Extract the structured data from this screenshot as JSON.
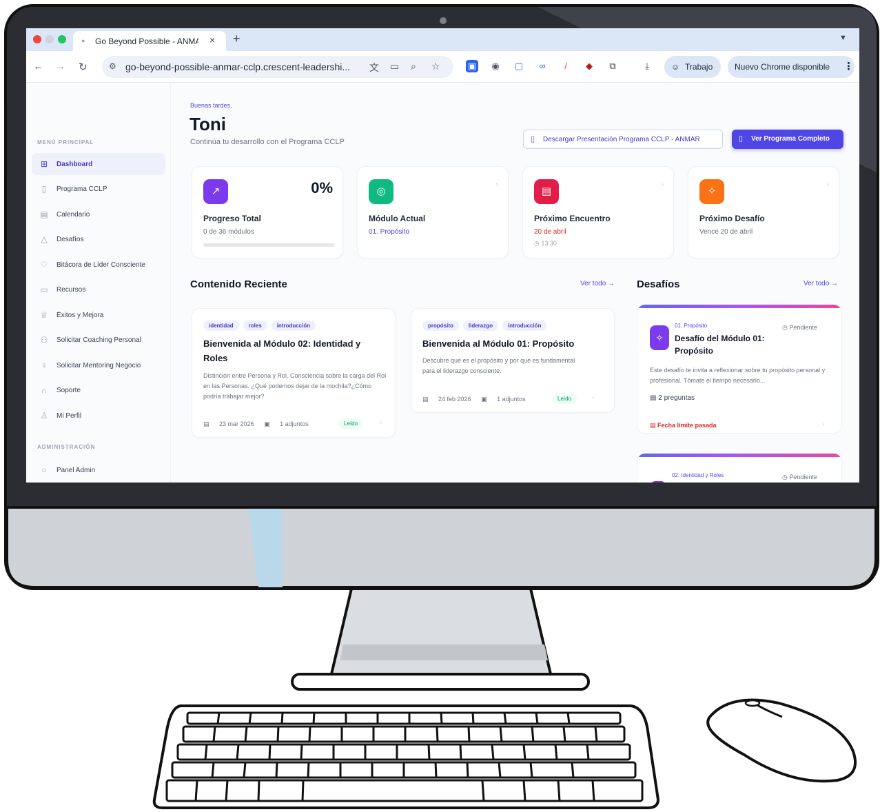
{
  "browser": {
    "tab_title": "Go Beyond Possible - ANMAR",
    "url": "go-beyond-possible-anmar-cclp.crescent-leadershi...",
    "profile_label": "Trabajo",
    "update_label": "Nuevo Chrome disponible"
  },
  "sidebar": {
    "section_main": "MENÚ PRINCIPAL",
    "items": [
      {
        "label": "Dashboard",
        "icon": "grid-icon"
      },
      {
        "label": "Programa CCLP",
        "icon": "book-icon"
      },
      {
        "label": "Calendario",
        "icon": "calendar-icon"
      },
      {
        "label": "Desafíos",
        "icon": "mountain-icon"
      },
      {
        "label": "Bitácora de Líder Consciente",
        "icon": "heart-icon"
      },
      {
        "label": "Recursos",
        "icon": "folder-icon"
      },
      {
        "label": "Éxitos y Mejora",
        "icon": "trophy-icon"
      },
      {
        "label": "Solicitar Coaching Personal",
        "icon": "users-icon"
      },
      {
        "label": "Solicitar Mentoring Negocio",
        "icon": "lightbulb-icon"
      },
      {
        "label": "Soporte",
        "icon": "headphones-icon"
      },
      {
        "label": "Mi Perfil",
        "icon": "user-icon"
      }
    ],
    "section_admin": "ADMINISTRACIÓN",
    "admin_items": [
      {
        "label": "Panel Admin",
        "icon": "shield-icon"
      }
    ]
  },
  "header": {
    "greeting": "Buenas tardes,",
    "user_name": "Toni",
    "subtitle": "Continúa tu desarrollo con el Programa CCLP",
    "download_button": "Descargar Presentación Programa CCLP - ANMAR",
    "view_program_button": "Ver Programa Completo"
  },
  "stats": {
    "progress": {
      "title": "Progreso Total",
      "value": "0%",
      "detail": "0 de 36 módulos",
      "fraction": 0
    },
    "module": {
      "title": "Módulo Actual",
      "value": "01. Propósito"
    },
    "meeting": {
      "title": "Próximo Encuentro",
      "value": "20 de abril",
      "time": "13:30"
    },
    "challenge": {
      "title": "Próximo Desafío",
      "value": "Vence 20 de abril"
    }
  },
  "recent": {
    "title": "Contenido Reciente",
    "see_all": "Ver todo →",
    "cards": [
      {
        "tags": [
          "identidad",
          "roles",
          "introducción"
        ],
        "title": "Bienvenida al Módulo 02: Identidad y Roles",
        "description": "Distinción entre Persona y Rol. Consciencia sobre la carga del Rol en las Personas. ¿Qué podemos dejar de la mochila?¿Cómo podría trabajar mejor?",
        "date": "23 mar 2026",
        "attachments": "1 adjuntos",
        "status": "Leído"
      },
      {
        "tags": [
          "propósito",
          "liderazgo",
          "introducción"
        ],
        "title": "Bienvenida al Módulo 01: Propósito",
        "description": "Descubre qué es el propósito y por qué es fundamental para el liderazgo consciente.",
        "date": "24 feb 2026",
        "attachments": "1 adjuntos",
        "status": "Leído"
      }
    ]
  },
  "challenges": {
    "title": "Desafíos",
    "see_all": "Ver todo →",
    "items": [
      {
        "module": "01. Propósito",
        "title": "Desafío del Módulo 01: Propósito",
        "status": "Pendiente",
        "description": "Este desafío te invita a reflexionar sobre tu propósito personal y profesional. Tómate el tiempo necesario...",
        "questions": "2 preguntas",
        "deadline": "Fecha límite pasada"
      },
      {
        "module": "02. Identidad y Roles",
        "status": "Pendiente"
      }
    ]
  },
  "colors": {
    "accent": "#4f46e5",
    "progress_badge": "#7c3aed",
    "module_badge": "#10b981",
    "meeting_badge": "#e11d48",
    "challenge_badge": "#f97316"
  }
}
